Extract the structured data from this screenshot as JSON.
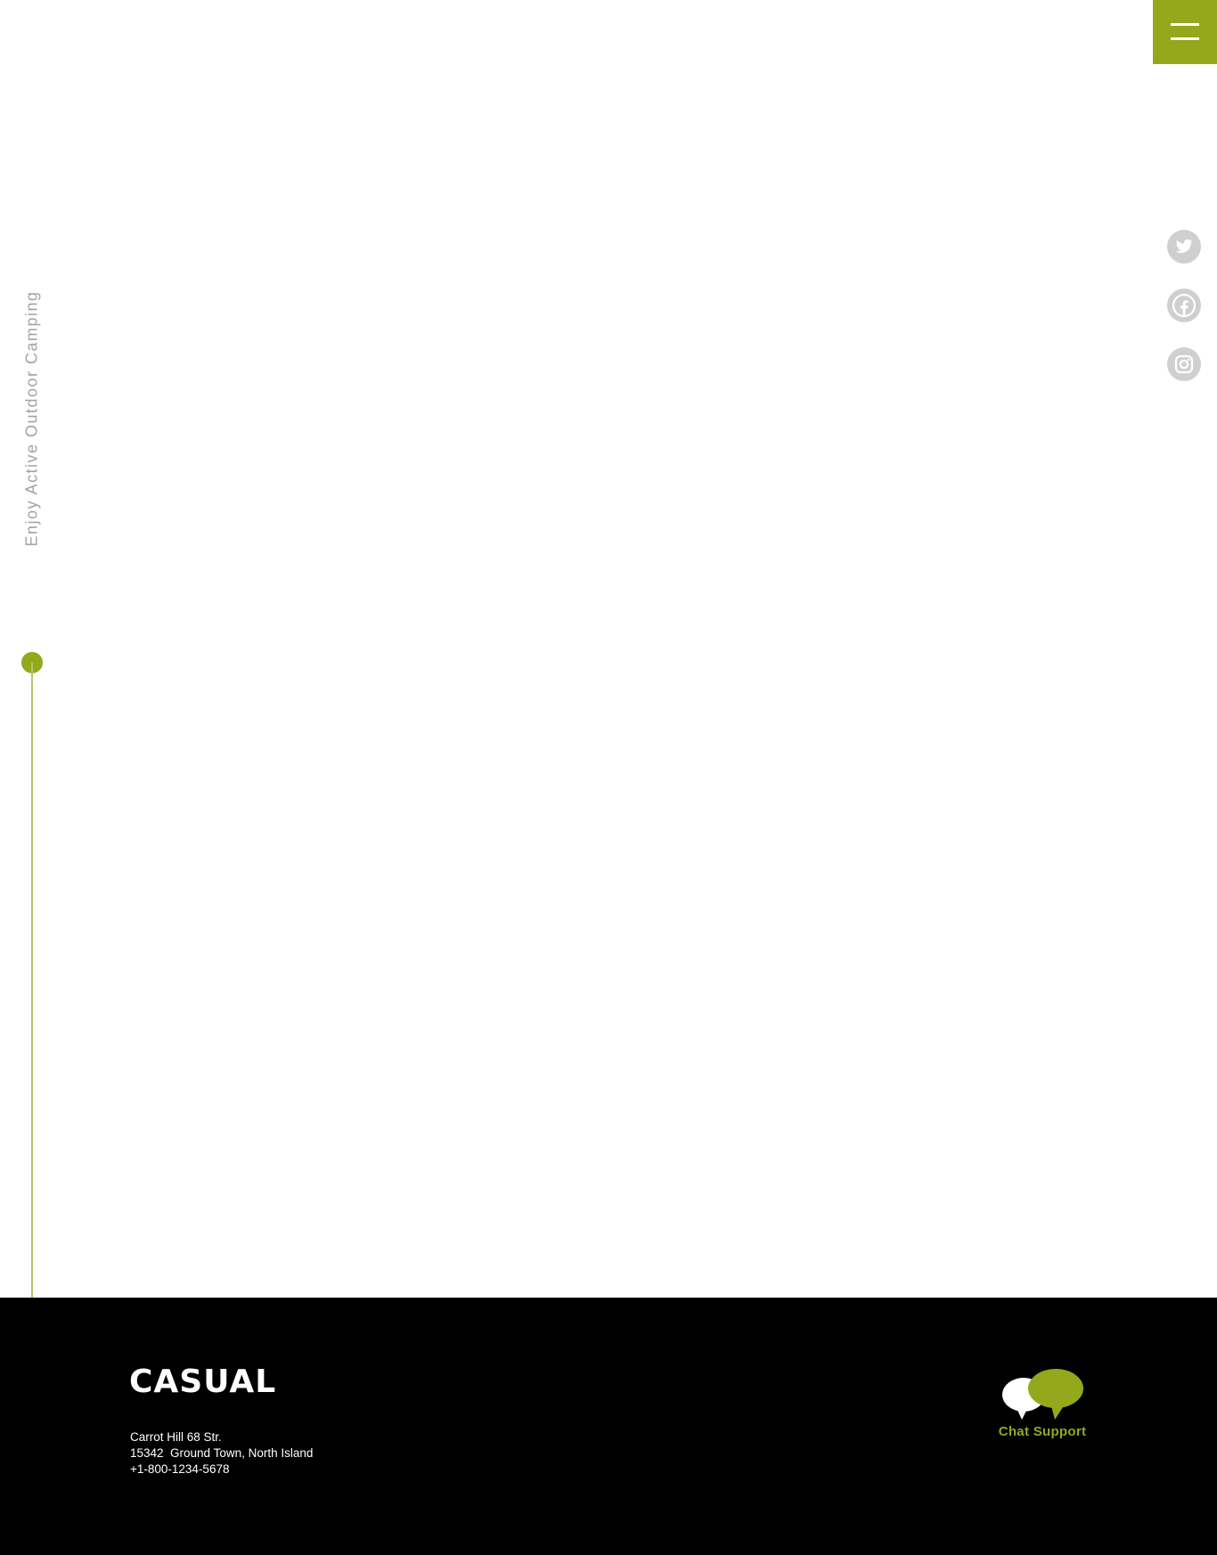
{
  "header": {
    "menu_icon": "hamburger-icon",
    "accent_color": "#94a81c"
  },
  "sidebar": {
    "tagline": "Enjoy Active Outdoor Camping"
  },
  "social": {
    "items": [
      {
        "name": "twitter",
        "icon": "twitter-icon"
      },
      {
        "name": "facebook",
        "icon": "facebook-icon"
      },
      {
        "name": "instagram",
        "icon": "instagram-icon"
      }
    ],
    "icon_color": "#cfcfcf"
  },
  "footer": {
    "brand": "CASUAL",
    "address_line1": "Carrot Hill 68 Str.",
    "address_line2": "15342  Ground Town, North Island",
    "phone": "+1-800-1234-5678",
    "chat_label": "Chat Support",
    "chat_icon": "chat-bubbles-icon",
    "background": "#000000"
  }
}
